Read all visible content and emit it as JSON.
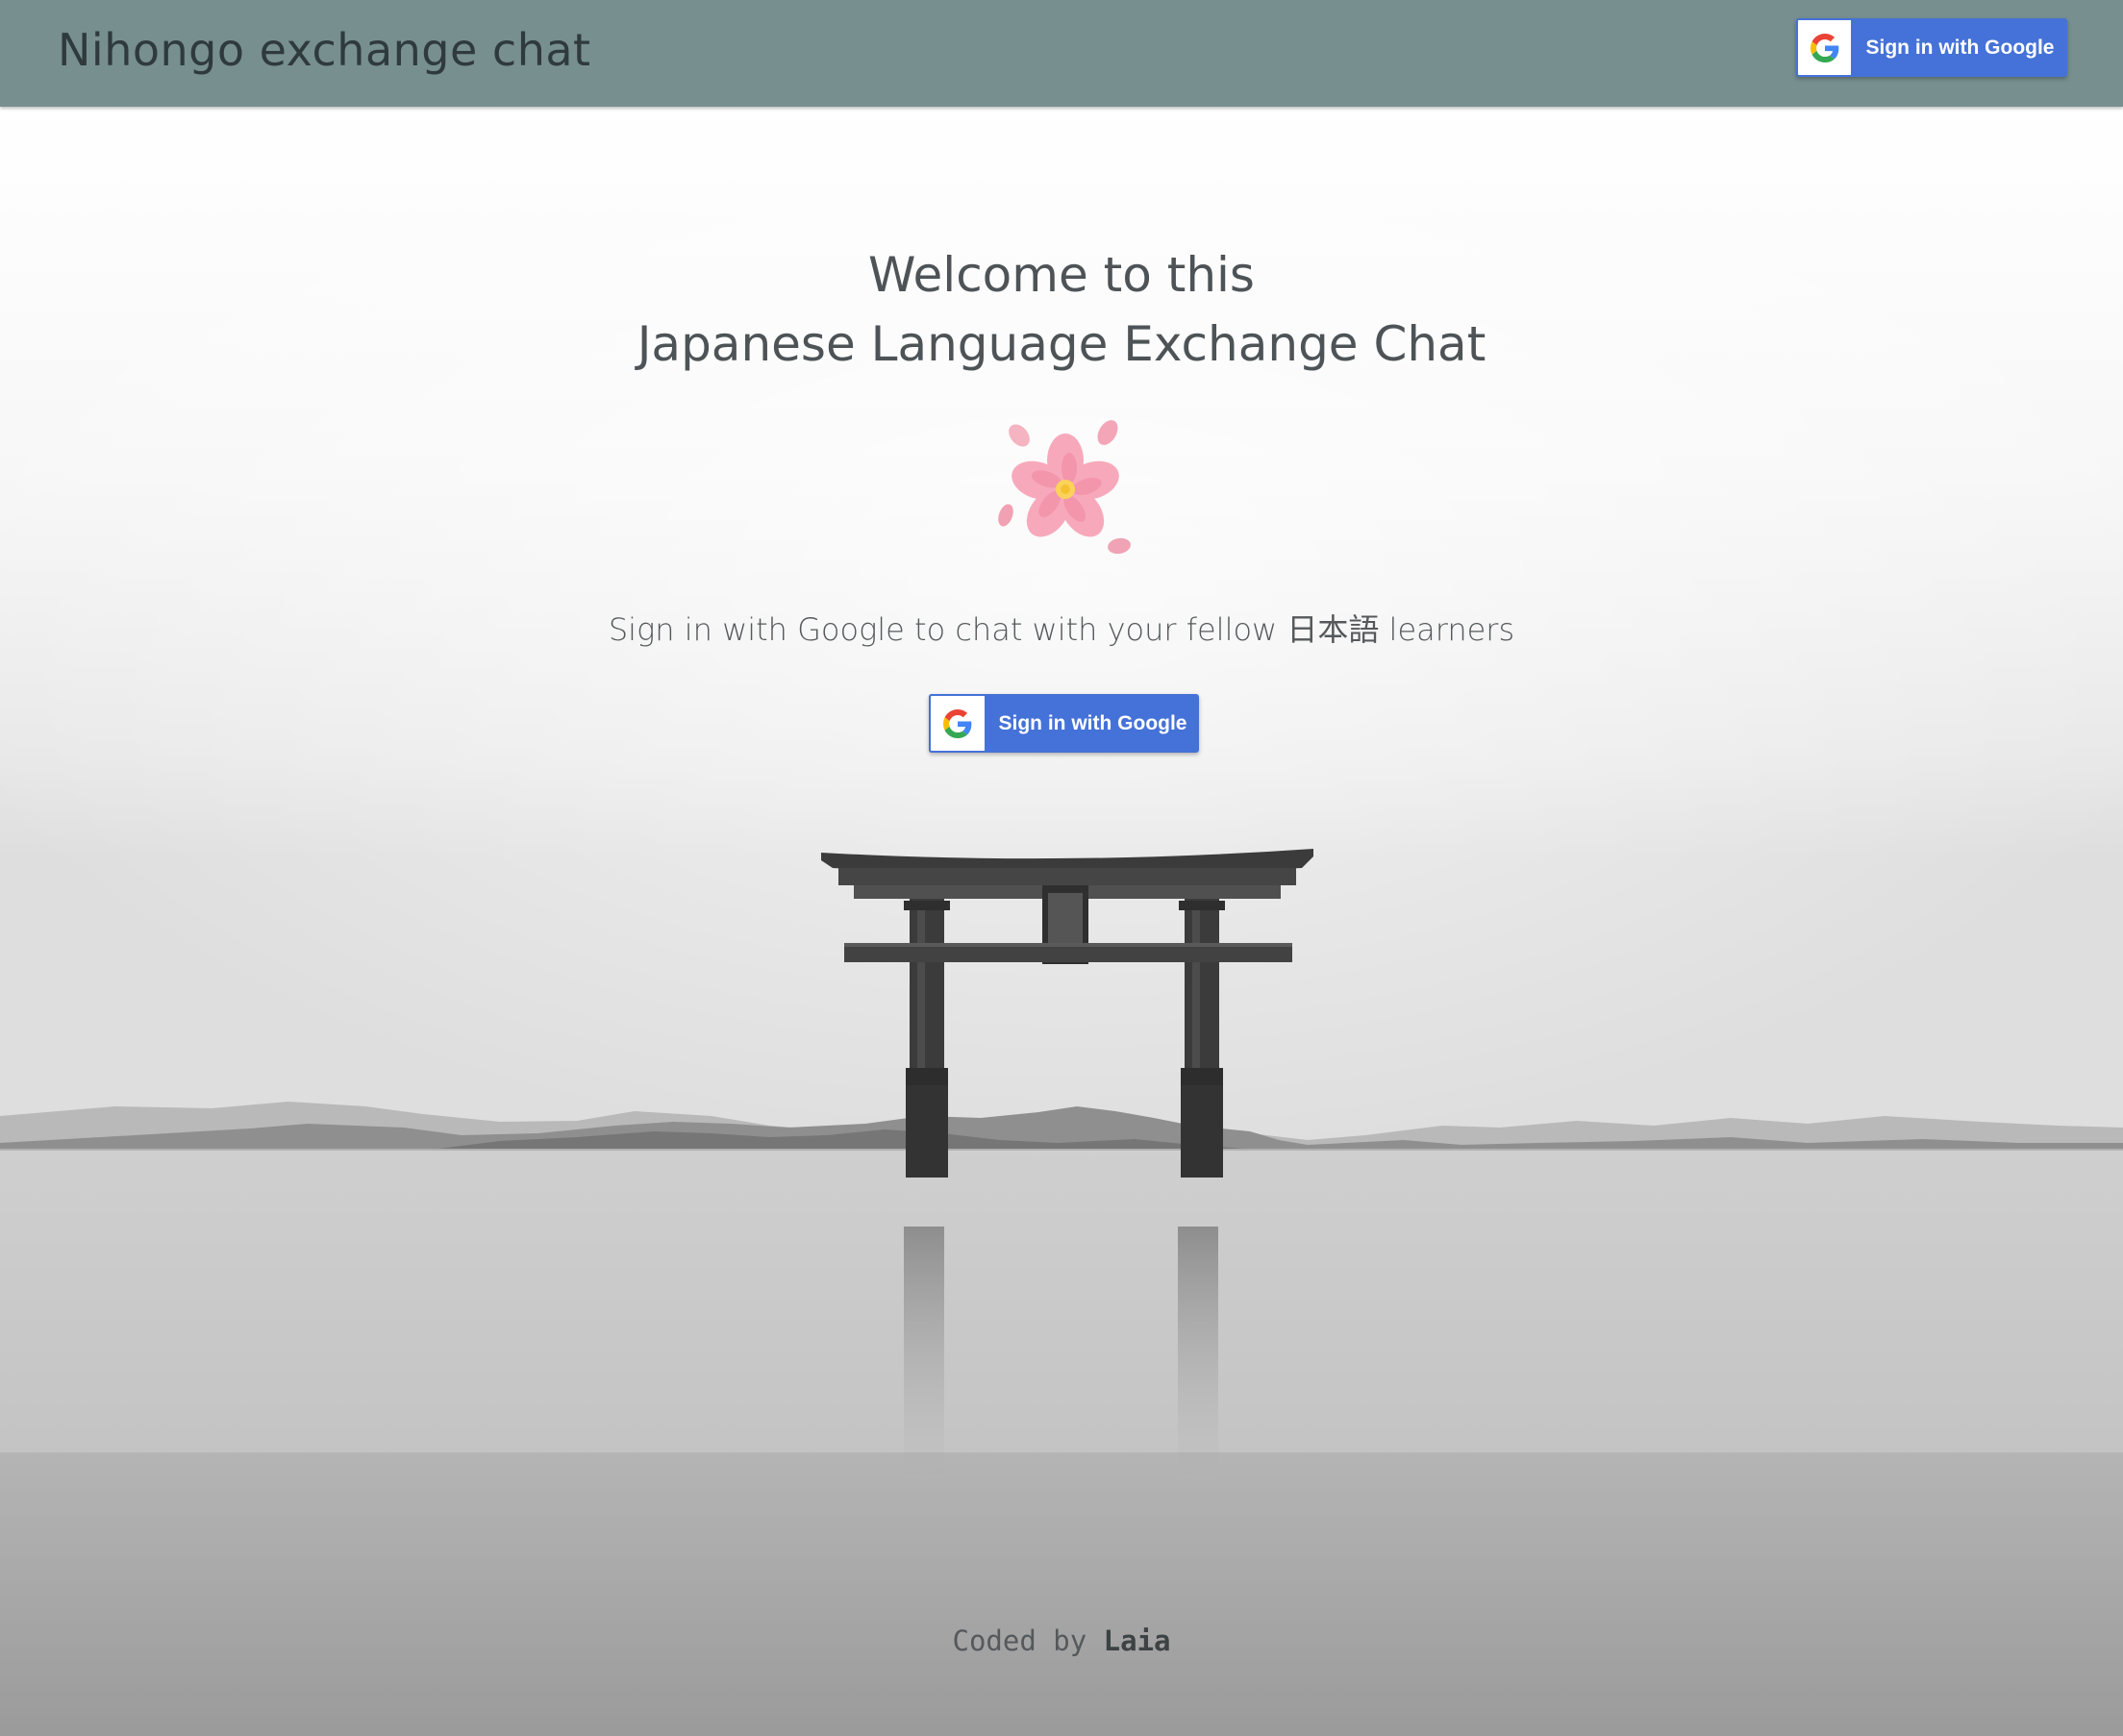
{
  "header": {
    "brand": "Nihongo exchange chat",
    "signin_label": "Sign in with Google",
    "background": "#778f8f"
  },
  "main": {
    "welcome_line1": "Welcome to this",
    "welcome_line2": "Japanese Language Exchange Chat",
    "flower_icon": "cherry-blossom-icon",
    "subtitle": "Sign in with Google to chat with your fellow 日本語 learners",
    "signin_label": "Sign in with Google",
    "button_color": "#4572d8"
  },
  "footer": {
    "prefix": "Coded by",
    "author": "Laia"
  }
}
